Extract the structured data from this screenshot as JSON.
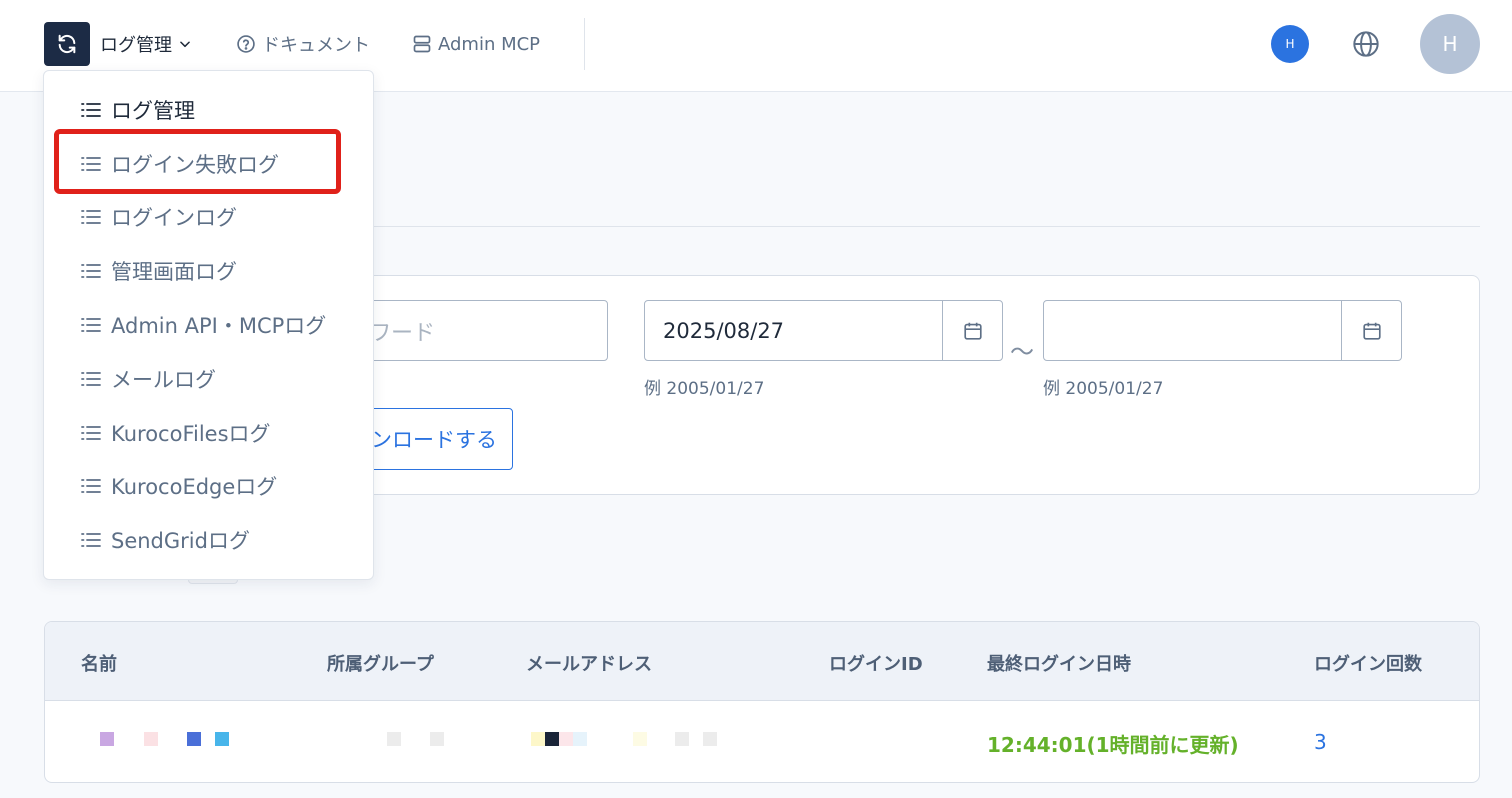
{
  "header": {
    "nav_main_label": "ログ管理",
    "nav_docs_label": "ドキュメント",
    "nav_mcp_label": "Admin MCP",
    "badge_letter": "H",
    "avatar_letter": "H"
  },
  "dropdown": {
    "items": [
      {
        "label": "ログ管理"
      },
      {
        "label": "ログイン失敗ログ"
      },
      {
        "label": "ログインログ"
      },
      {
        "label": "管理画面ログ"
      },
      {
        "label": "Admin API・MCPログ"
      },
      {
        "label": "メールログ"
      },
      {
        "label": "KurocoFilesログ"
      },
      {
        "label": "KurocoEdgeログ"
      },
      {
        "label": "SendGridログ"
      }
    ],
    "highlighted_item": "ログイン失敗ログ"
  },
  "filters": {
    "keyword_placeholder_visible": "ワード",
    "date_from_value": "2025/08/27",
    "date_to_value": "",
    "date_separator": "～",
    "date_hint_from": "例 2005/01/27",
    "date_hint_to": "例 2005/01/27",
    "download_label_visible": "ンロードする"
  },
  "table": {
    "headers": [
      "名前",
      "所属グループ",
      "メールアドレス",
      "ログインID",
      "最終ログイン日時",
      "ログイン回数"
    ],
    "rows": [
      {
        "last_login": "12:44:01(1時間前に更新)",
        "login_count": "3"
      }
    ]
  },
  "colors": {
    "brand_dark": "#1c2b45",
    "accent_blue": "#2b73e0",
    "success_green": "#64b12a",
    "highlight_red": "#e0211a",
    "text_muted": "#5d6f86"
  },
  "icons": {
    "app": "refresh-icon",
    "nav_dropdown": "chevron-down-icon",
    "docs": "question-circle-icon",
    "mcp": "server-icon",
    "language": "globe-icon",
    "date": "calendar-icon",
    "menu_item": "list-icon"
  }
}
